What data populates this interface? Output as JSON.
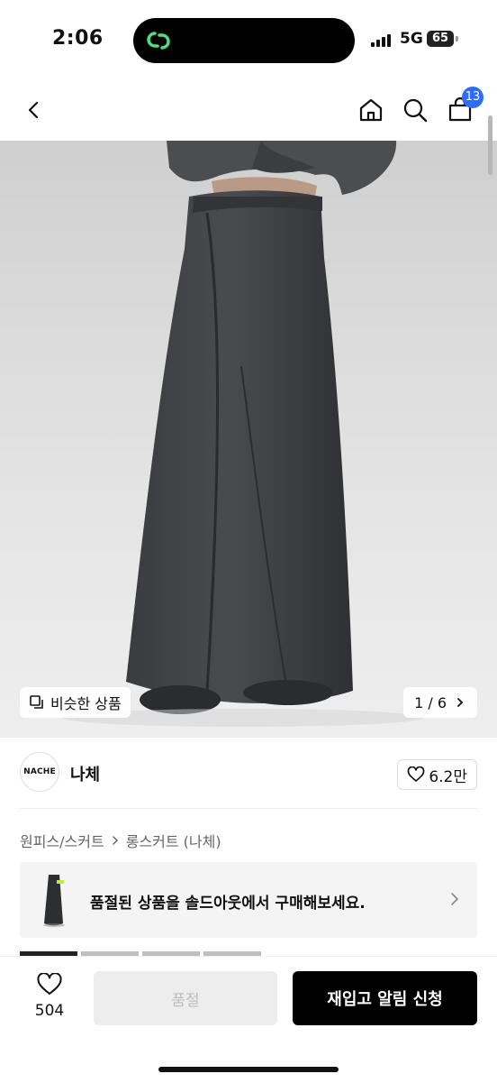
{
  "status_bar": {
    "time": "2:06",
    "network": "5G",
    "battery": "65"
  },
  "top_nav": {
    "cart_count": "13"
  },
  "hero": {
    "similar_label": "비슷한 상품",
    "counter": "1 / 6",
    "scroll_position": 0.17
  },
  "brand": {
    "logo_text": "NACHE",
    "name": "나체",
    "likes": "6.2만"
  },
  "breadcrumb": {
    "level1": "원피스/스커트",
    "level2": "롱스커트 (나체)"
  },
  "soldout_banner": {
    "text": "품절된 상품을 솔드아웃에서 구매해보세요."
  },
  "gallery": {
    "active_index": 0,
    "thumb_count": 4
  },
  "bottom_bar": {
    "wish_count": "504",
    "soldout_label": "품절",
    "restock_label": "재입고 알림 신청"
  },
  "colors": {
    "accent": "#2f6bff",
    "app_logo": "#4ade80",
    "primary_button": "#000000"
  }
}
